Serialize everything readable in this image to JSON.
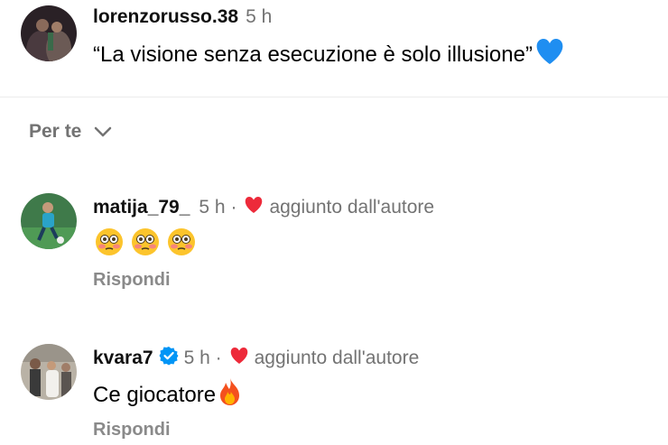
{
  "top_comment": {
    "username": "lorenzorusso.38",
    "time": "5 h",
    "text": "“La visione senza esecuzione è solo illusione”",
    "emoji_icon": "blue-heart-icon"
  },
  "filter": {
    "label": "Per te",
    "icon": "chevron-down-icon"
  },
  "comments": [
    {
      "username": "matija_79_",
      "time": "5 h ·",
      "liked_label": "aggiunto dall'autore",
      "text_icons": [
        "flushed-face-icon",
        "flushed-face-icon",
        "flushed-face-icon"
      ],
      "reply_label": "Rispondi"
    },
    {
      "username": "kvara7",
      "verified": true,
      "time": "5 h ·",
      "liked_label": "aggiunto dall'autore",
      "text": "Ce giocatore",
      "text_icon": "fire-icon",
      "reply_label": "Rispondi"
    }
  ],
  "colors": {
    "heart_red": "#ed2a3a",
    "verified_blue": "#0095f6",
    "meta_gray": "#737373"
  }
}
